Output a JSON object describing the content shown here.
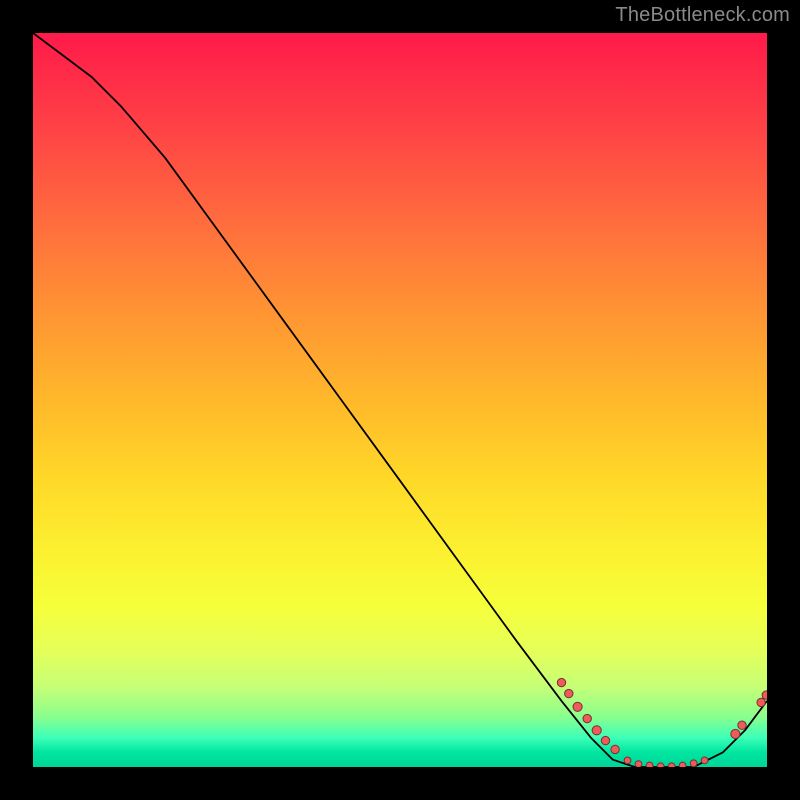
{
  "attribution": "TheBottleneck.com",
  "colors": {
    "frame_bg": "#000000",
    "attribution_text": "#8a8a8a",
    "curve": "#000000",
    "dot_fill": "#ef5a5a",
    "dot_stroke": "#74332e",
    "label_fill": "#b23c34"
  },
  "chart_data": {
    "type": "line",
    "title": "",
    "xlabel": "",
    "ylabel": "",
    "xlim": [
      0,
      100
    ],
    "ylim": [
      0,
      100
    ],
    "x": [
      0,
      4,
      8,
      12,
      18,
      26,
      34,
      42,
      50,
      58,
      66,
      72,
      76,
      79,
      82,
      86,
      90,
      94,
      97,
      100
    ],
    "values": [
      100,
      97,
      94,
      90,
      83,
      72,
      61,
      50,
      39,
      28,
      17,
      9,
      4,
      1,
      0,
      0,
      0,
      2,
      5,
      9
    ],
    "series": [
      {
        "name": "bottleneck-curve",
        "x": [
          0,
          4,
          8,
          12,
          18,
          26,
          34,
          42,
          50,
          58,
          66,
          72,
          76,
          79,
          82,
          86,
          90,
          94,
          97,
          100
        ],
        "y": [
          100,
          97,
          94,
          90,
          83,
          72,
          61,
          50,
          39,
          28,
          17,
          9,
          4,
          1,
          0,
          0,
          0,
          2,
          5,
          9
        ]
      }
    ],
    "markers": [
      {
        "x": 72.0,
        "y": 11.5,
        "r": 4.2
      },
      {
        "x": 73.0,
        "y": 10.0,
        "r": 4.2
      },
      {
        "x": 74.2,
        "y": 8.2,
        "r": 4.6
      },
      {
        "x": 75.5,
        "y": 6.6,
        "r": 4.2
      },
      {
        "x": 76.8,
        "y": 5.0,
        "r": 4.6
      },
      {
        "x": 78.0,
        "y": 3.6,
        "r": 4.2
      },
      {
        "x": 79.3,
        "y": 2.4,
        "r": 4.2
      },
      {
        "x": 81.0,
        "y": 0.9,
        "r": 3.4
      },
      {
        "x": 82.5,
        "y": 0.4,
        "r": 3.4
      },
      {
        "x": 84.0,
        "y": 0.2,
        "r": 3.4
      },
      {
        "x": 85.5,
        "y": 0.1,
        "r": 3.4
      },
      {
        "x": 87.0,
        "y": 0.1,
        "r": 3.4
      },
      {
        "x": 88.5,
        "y": 0.2,
        "r": 3.4
      },
      {
        "x": 90.0,
        "y": 0.5,
        "r": 3.4
      },
      {
        "x": 91.5,
        "y": 0.9,
        "r": 3.4
      },
      {
        "x": 95.7,
        "y": 4.5,
        "r": 4.6
      },
      {
        "x": 96.6,
        "y": 5.7,
        "r": 4.2
      },
      {
        "x": 99.2,
        "y": 8.8,
        "r": 4.2
      },
      {
        "x": 99.9,
        "y": 9.8,
        "r": 4.2
      }
    ],
    "annotations": [
      {
        "text": "",
        "x": 86,
        "y": 0.2
      }
    ]
  }
}
